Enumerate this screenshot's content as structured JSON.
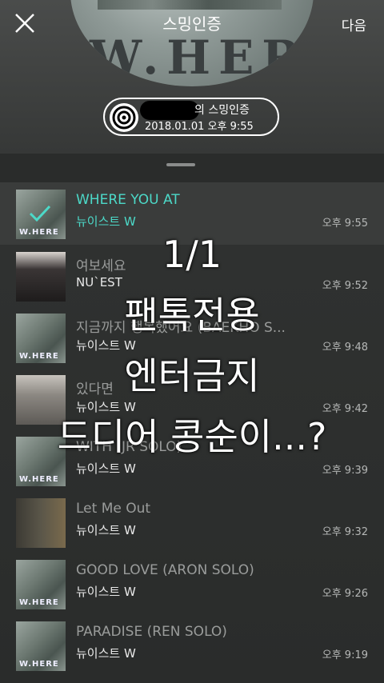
{
  "header": {
    "title": "스밍인증",
    "next_label": "다음",
    "close_icon": "close-icon",
    "album_letters": "W.HERE"
  },
  "certificate": {
    "title": "의 스밍인증",
    "datetime": "2018.01.01 오후 9:55",
    "icon": "disc-icon"
  },
  "songs": [
    {
      "title": "WHERE YOU AT",
      "artist": "뉴이스트 W",
      "time": "오후 9:55",
      "active": true
    },
    {
      "title": "여보세요",
      "artist": "NU`EST",
      "time": "오후 9:52"
    },
    {
      "title": "지금까지 행복했어요 (BAEKHO S...",
      "artist": "뉴이스트 W",
      "time": "오후 9:48"
    },
    {
      "title": "있다면",
      "artist": "뉴이스트 W",
      "time": "오후 9:42"
    },
    {
      "title": "WITH (JR SOLO)",
      "artist": "뉴이스트 W",
      "time": "오후 9:39"
    },
    {
      "title": "Let Me Out",
      "artist": "뉴이스트 W",
      "time": "오후 9:32"
    },
    {
      "title": "GOOD LOVE (ARON SOLO)",
      "artist": "뉴이스트 W",
      "time": "오후 9:26"
    },
    {
      "title": "PARADISE (REN SOLO)",
      "artist": "뉴이스트 W",
      "time": "오후 9:19"
    }
  ],
  "overlay_text": [
    "1/1",
    "팬톡전용",
    "엔터금지",
    "드디어 콩순이...?"
  ],
  "colors": {
    "accent": "#4cd9c8",
    "background": "#2b2e2c"
  }
}
